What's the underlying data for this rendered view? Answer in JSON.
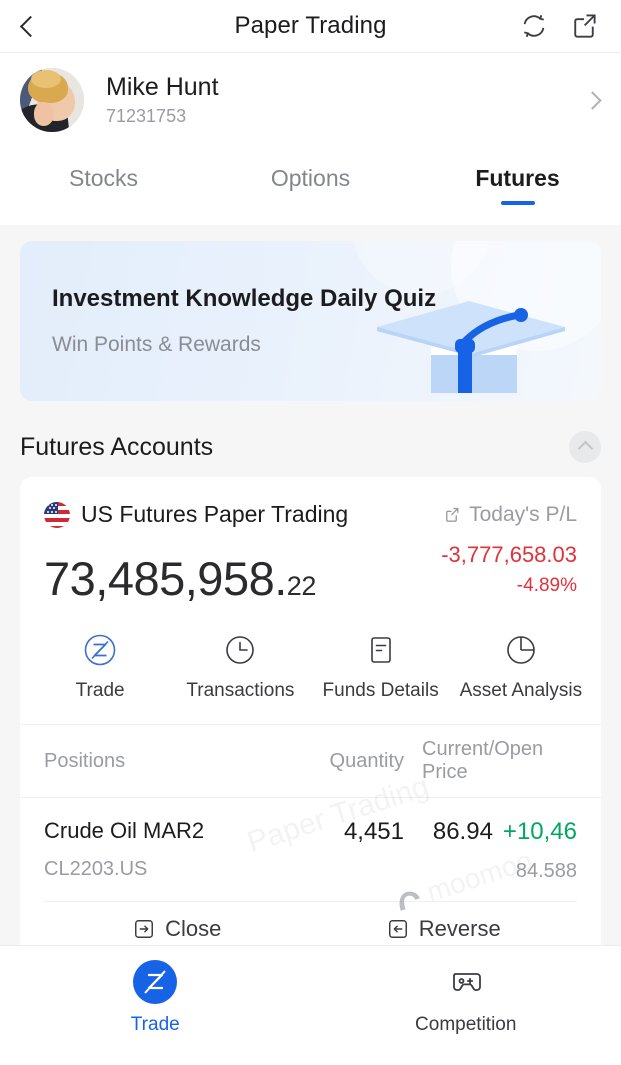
{
  "topbar": {
    "title": "Paper Trading",
    "back_icon": "chevron-left-icon",
    "refresh_icon": "refresh-icon",
    "share_icon": "share-icon"
  },
  "account": {
    "name": "Mike Hunt",
    "id": "71231753",
    "avatar_icon": "avatar-photo",
    "chevron_icon": "chevron-right-icon"
  },
  "tabs": [
    {
      "label": "Stocks",
      "active": false
    },
    {
      "label": "Options",
      "active": false
    },
    {
      "label": "Futures",
      "active": true
    }
  ],
  "banner": {
    "title": "Investment Knowledge Daily Quiz",
    "subtitle": "Win Points & Rewards",
    "illustration_icon": "graduation-cap-icon"
  },
  "section": {
    "title": "Futures Accounts",
    "collapse_icon": "chevron-up-icon"
  },
  "account_card": {
    "flag_icon": "us-flag-icon",
    "title": "US Futures Paper Trading",
    "pl_label": "Today's P/L",
    "pl_share_icon": "share-icon",
    "balance_main": "73,485,958.",
    "balance_cents": "22",
    "pl_amount": "-3,777,658.03",
    "pl_percent": "-4.89%",
    "pl_color": "#e0323c",
    "actions": [
      {
        "label": "Trade",
        "icon": "trade-z-icon"
      },
      {
        "label": "Transactions",
        "icon": "clock-icon"
      },
      {
        "label": "Funds Details",
        "icon": "document-icon"
      },
      {
        "label": "Asset Analysis",
        "icon": "pie-chart-icon"
      }
    ],
    "table": {
      "headers": {
        "positions": "Positions",
        "quantity": "Quantity",
        "price": "Current/Open Price"
      },
      "rows": [
        {
          "name": "Crude Oil MAR2",
          "code": "CL2203.US",
          "quantity": "4,451",
          "current_price": "86.94",
          "change": "+10,46",
          "change_color": "#00a862",
          "open_price": "84.588"
        }
      ],
      "row_buttons": [
        {
          "label": "Close",
          "icon": "close-position-icon"
        },
        {
          "label": "Reverse",
          "icon": "reverse-position-icon"
        }
      ]
    }
  },
  "watermarks": {
    "paper_trading": "Paper Trading",
    "moomoo": "moomoo"
  },
  "bottom_nav": [
    {
      "label": "Trade",
      "icon": "trade-z-icon",
      "active": true
    },
    {
      "label": "Competition",
      "icon": "gamepad-icon",
      "active": false
    }
  ]
}
